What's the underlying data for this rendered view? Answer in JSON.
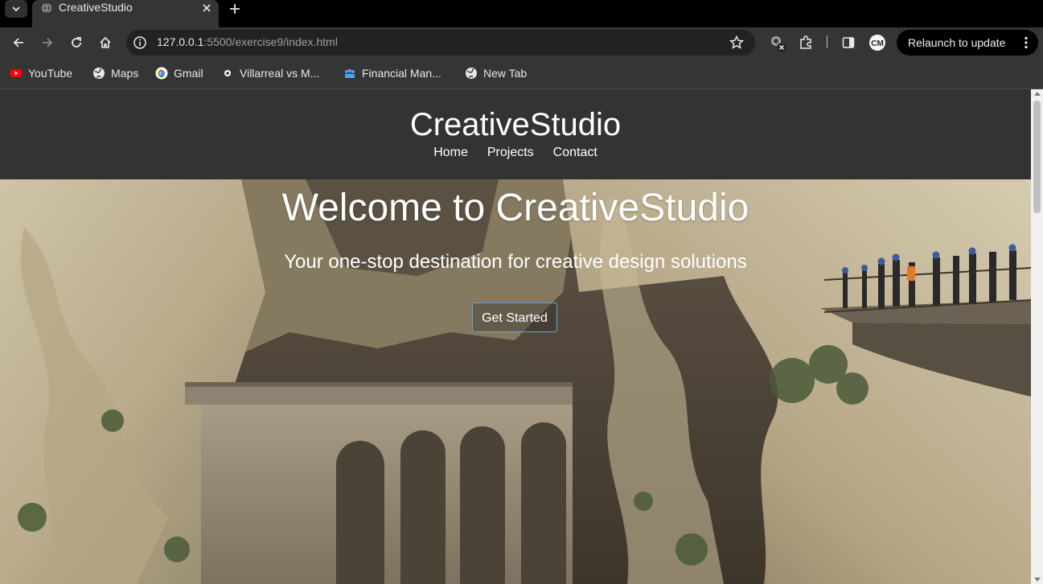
{
  "browser": {
    "tab": {
      "title": "CreativeStudio",
      "favicon": "globe-icon"
    },
    "url": {
      "host": "127.0.0.1",
      "rest": ":5500/exercise9/index.html"
    },
    "relaunch_label": "Relaunch to update",
    "profile_initials": "CM",
    "bookmarks": [
      {
        "label": "YouTube",
        "icon": "youtube-icon"
      },
      {
        "label": "Maps",
        "icon": "globe-icon"
      },
      {
        "label": "Gmail",
        "icon": "google-icon"
      },
      {
        "label": "Villarreal vs M...",
        "icon": "soccer-icon"
      },
      {
        "label": "Financial Man...",
        "icon": "people-icon"
      },
      {
        "label": "New Tab",
        "icon": "globe-icon"
      }
    ]
  },
  "site": {
    "logo": "CreativeStudio",
    "nav": [
      "Home",
      "Projects",
      "Contact"
    ],
    "hero": {
      "title": "Welcome to CreativeStudio",
      "subtitle": "Your one-stop destination for creative design solutions",
      "cta": "Get Started"
    }
  },
  "colors": {
    "header_bg": "#333333",
    "cta_border": "#5fa8e0",
    "chrome_bg": "#353535"
  }
}
